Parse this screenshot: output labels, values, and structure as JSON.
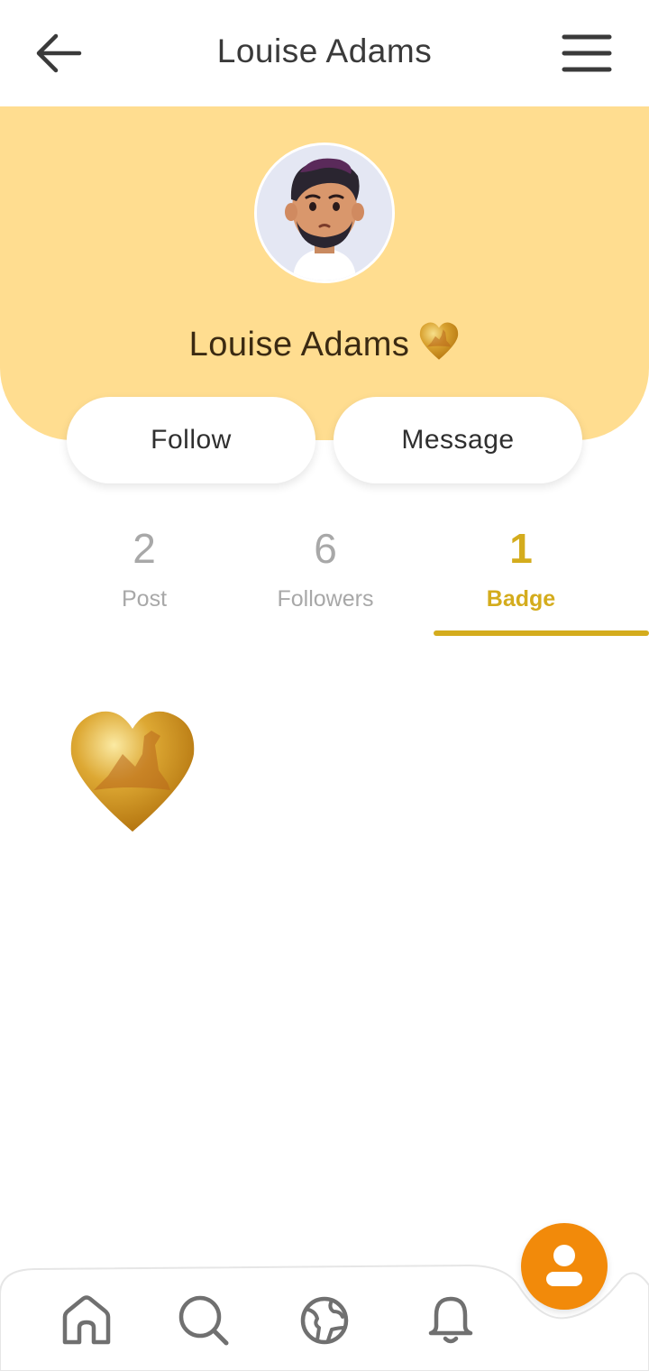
{
  "header": {
    "title": "Louise Adams",
    "back_icon": "arrow-left-icon",
    "menu_icon": "hamburger-menu-icon"
  },
  "profile": {
    "name": "Louise Adams",
    "avatar_icon": "avatar-3d-man",
    "badge_icon": "gold-heart-badge-icon",
    "accent_color": "#ffdd90"
  },
  "actions": {
    "follow_label": "Follow",
    "message_label": "Message"
  },
  "stats": [
    {
      "value": "2",
      "label": "Post"
    },
    {
      "value": "6",
      "label": "Followers"
    },
    {
      "value": "1",
      "label": "Badge"
    }
  ],
  "active_tab": "Badge",
  "active_color": "#d4ac1d",
  "badges": [
    {
      "icon": "gold-heart-badge-icon"
    }
  ],
  "bottom_nav": {
    "items": [
      "home-icon",
      "search-icon",
      "globe-icon",
      "bell-icon"
    ],
    "fab_icon": "profile-icon",
    "fab_color": "#f28a0a"
  }
}
